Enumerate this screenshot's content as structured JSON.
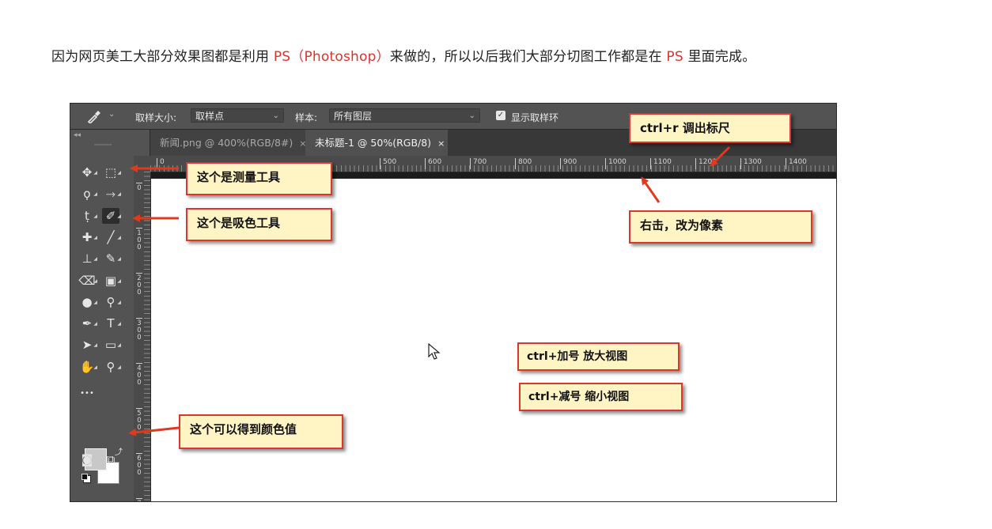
{
  "intro": {
    "part1": "因为网页美工大部分效果图都是利用 ",
    "highlight1": "PS（Photoshop）",
    "part2": "来做的，所以以后我们大部分切图工作都是在 ",
    "highlight2": "PS",
    "part3": " 里面完成。"
  },
  "options_bar": {
    "tool_icon": "eyedropper-icon",
    "sample_size_label": "取样大小:",
    "sample_size_value": "取样点",
    "sample_label": "样本:",
    "sample_value": "所有图层",
    "show_ring_label": "显示取样环",
    "show_ring_checked": true
  },
  "tabs": [
    {
      "label": "新闻.png @ 400%(RGB/8#)",
      "close": "×",
      "active": false
    },
    {
      "label": "未标题-1 @ 50%(RGB/8)",
      "close": "×",
      "active": true
    }
  ],
  "ruler": {
    "h_labels": [
      "0",
      "500",
      "600",
      "700",
      "800",
      "900",
      "1000",
      "1100",
      "1200",
      "1300",
      "1400"
    ],
    "v_labels": [
      "0",
      "100",
      "200",
      "300",
      "400",
      "500",
      "600",
      "7"
    ]
  },
  "tools": [
    {
      "name": "move-tool",
      "icon": "move-icon",
      "glyph": "✥"
    },
    {
      "name": "marquee-tool",
      "icon": "marquee-icon",
      "glyph": "⬚"
    },
    {
      "name": "lasso-tool",
      "icon": "lasso-icon",
      "glyph": "ϙ"
    },
    {
      "name": "quick-select-tool",
      "icon": "quick-select-icon",
      "glyph": "⤑"
    },
    {
      "name": "crop-tool",
      "icon": "crop-icon",
      "glyph": "ṭ"
    },
    {
      "name": "eyedropper-tool",
      "icon": "eyedropper-icon",
      "glyph": "✐"
    },
    {
      "name": "healing-tool",
      "icon": "healing-icon",
      "glyph": "✚"
    },
    {
      "name": "brush-tool",
      "icon": "brush-icon",
      "glyph": "╱"
    },
    {
      "name": "stamp-tool",
      "icon": "stamp-icon",
      "glyph": "⊥"
    },
    {
      "name": "history-brush-tool",
      "icon": "history-brush-icon",
      "glyph": "✎"
    },
    {
      "name": "eraser-tool",
      "icon": "eraser-icon",
      "glyph": "⌫"
    },
    {
      "name": "gradient-tool",
      "icon": "gradient-icon",
      "glyph": "▣"
    },
    {
      "name": "blur-tool",
      "icon": "blur-icon",
      "glyph": "●"
    },
    {
      "name": "dodge-tool",
      "icon": "dodge-icon",
      "glyph": "⚲"
    },
    {
      "name": "pen-tool",
      "icon": "pen-icon",
      "glyph": "✒"
    },
    {
      "name": "type-tool",
      "icon": "type-icon",
      "glyph": "T"
    },
    {
      "name": "path-select-tool",
      "icon": "path-select-icon",
      "glyph": "➤"
    },
    {
      "name": "rectangle-tool",
      "icon": "rectangle-icon",
      "glyph": "▭"
    },
    {
      "name": "hand-tool",
      "icon": "hand-icon",
      "glyph": "✋"
    },
    {
      "name": "zoom-tool",
      "icon": "zoom-icon",
      "glyph": "⚲"
    },
    {
      "name": "more-tools",
      "icon": "more-icon",
      "glyph": "•••"
    },
    {
      "name": "quick-mask",
      "icon": "quick-mask-icon",
      "glyph": "◙"
    },
    {
      "name": "screen-mode",
      "icon": "screen-mode-icon",
      "glyph": "⧉"
    }
  ],
  "colors": {
    "foreground": "#c8c8c8",
    "background": "#ffffff",
    "callout_fill": "#fff5c4",
    "callout_border": "#d9382b",
    "arrow": "#e03a1e",
    "highlight_text": "#e0322c"
  },
  "callouts": {
    "ruler_shortcut": "ctrl+r 调出标尺",
    "measure_tool": "这个是测量工具",
    "eyedropper_tool": "这个是吸色工具",
    "right_click_pixels": "右击，改为像素",
    "zoom_in": "ctrl+加号 放大视图",
    "zoom_out": "ctrl+减号 缩小视图",
    "color_value": "这个可以得到颜色值"
  }
}
